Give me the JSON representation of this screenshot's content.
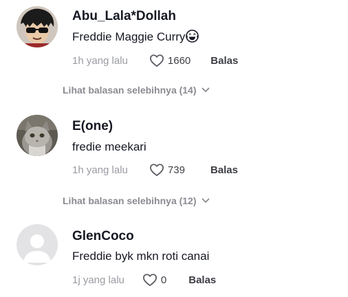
{
  "comments": [
    {
      "username": "Abu_Lala*Dollah",
      "text": "Freddie Maggie Curry",
      "emoji": "tears-of-joy-emoji",
      "time": "1h yang lalu",
      "likes": "1660",
      "reply_label": "Balas",
      "avatar": "cartoon-sunglasses-avatar"
    },
    {
      "username": "E(one)",
      "text": "fredie meekari",
      "time": "1h yang lalu",
      "likes": "739",
      "reply_label": "Balas",
      "avatar": "cat-photo-avatar"
    },
    {
      "username": "GlenCoco",
      "text": "Freddie byk mkn roti canai",
      "time": "1j yang lalu",
      "likes": "0",
      "reply_label": "Balas",
      "avatar": "default-user-avatar"
    }
  ],
  "more_replies": [
    {
      "label": "Lihat balasan selebihnya (14)"
    },
    {
      "label": "Lihat balasan selebihnya (12)"
    }
  ],
  "colors": {
    "text_primary": "#161823",
    "text_secondary": "#9a9ba2",
    "default_avatar_bg": "#e3e3e5"
  }
}
